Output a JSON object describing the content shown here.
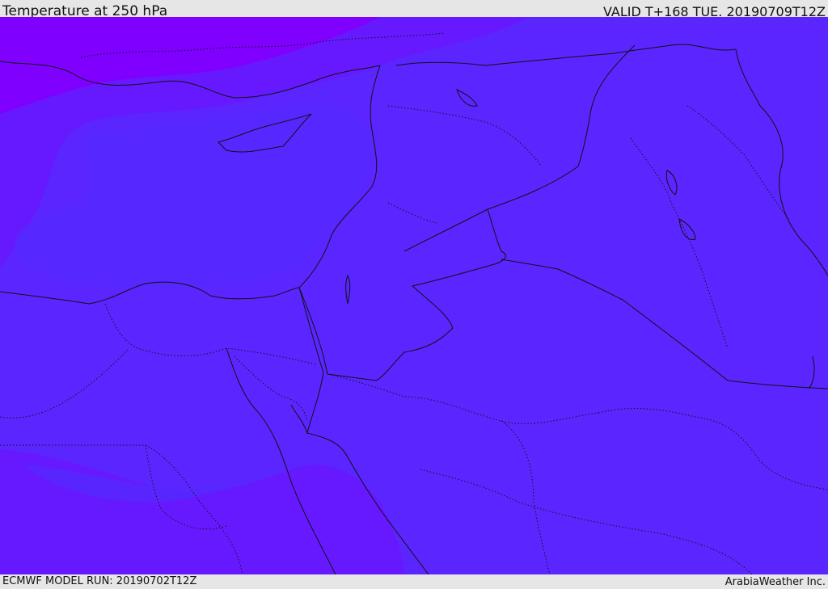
{
  "header": {
    "title": "Temperature at 250 hPa",
    "valid_time": "VALID T+168 TUE. 20190709T12Z"
  },
  "footer": {
    "model_run": "ECMWF MODEL RUN: 20190702T12Z",
    "credit": "ArabiaWeather Inc."
  },
  "map": {
    "field": "Temperature at 250 hPa",
    "colors": {
      "cold_band_north": "#7f00ff",
      "cool_band": "#6619ff",
      "main_band": "#5b25ff",
      "light_band": "#5528ff",
      "border_line": "#111111"
    }
  }
}
